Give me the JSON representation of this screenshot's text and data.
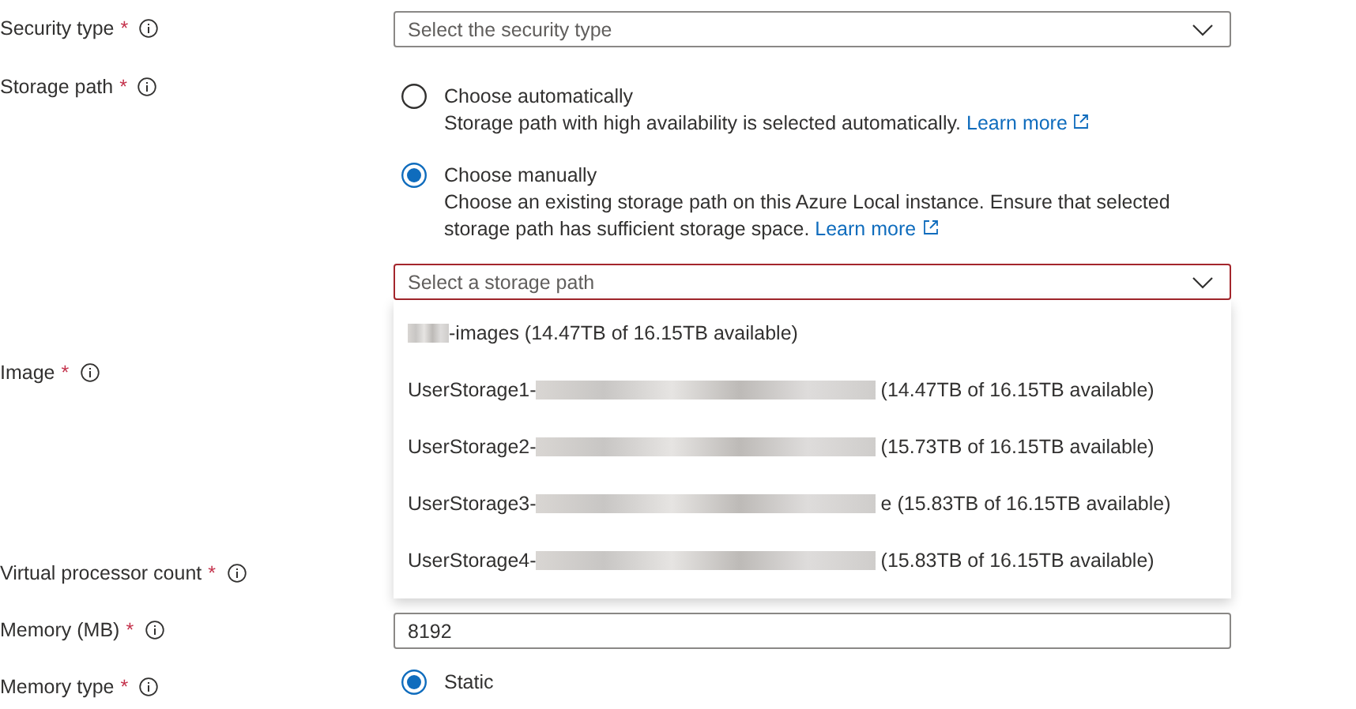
{
  "fields": [
    {
      "label": "Security type",
      "required": "*",
      "kind": "select",
      "placeholder": "Select the security type",
      "invalid": false
    },
    {
      "label": "Storage path",
      "required": "*",
      "kind": "radios",
      "options": [
        {
          "label": "Choose automatically",
          "description": "Storage path with high availability is selected automatically.",
          "link": "Learn more",
          "selected": false
        },
        {
          "label": "Choose manually",
          "description": "Choose an existing storage path on this Azure Local instance. Ensure that selected storage path has sufficient storage space.",
          "link": "Learn more",
          "selected": true
        }
      ],
      "select": {
        "placeholder": "Select a storage path",
        "invalid": true,
        "expanded": true,
        "items": [
          {
            "suffix": "-images (14.47TB of 16.15TB available)"
          },
          {
            "prefix": "UserStorage1-",
            "suffix": "(14.47TB of 16.15TB available)"
          },
          {
            "prefix": "UserStorage2-",
            "suffix": "(15.73TB of 16.15TB available)"
          },
          {
            "prefix": "UserStorage3-",
            "suffix": "e (15.83TB of 16.15TB available)"
          },
          {
            "prefix": "UserStorage4-",
            "suffix": "(15.83TB of 16.15TB available)"
          }
        ]
      }
    },
    {
      "label": "Image",
      "required": "*",
      "kind": "covered"
    },
    {
      "label": "Virtual processor count",
      "required": "*",
      "kind": "covered-input"
    },
    {
      "label": "Memory (MB)",
      "required": "*",
      "kind": "text",
      "value": "8192"
    },
    {
      "label": "Memory type",
      "required": "*",
      "kind": "radios",
      "options": [
        {
          "label": "Static",
          "selected": true
        }
      ]
    }
  ]
}
